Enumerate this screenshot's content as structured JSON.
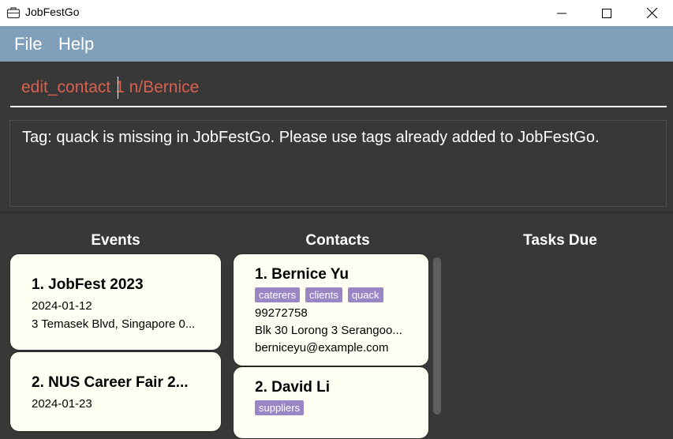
{
  "window": {
    "title": "JobFestGo",
    "app_icon": "briefcase-icon",
    "controls": [
      "minimize-icon",
      "maximize-icon",
      "close-icon"
    ]
  },
  "menu": {
    "file": "File",
    "help": "Help"
  },
  "command": {
    "value": "edit_contact 1 n/Bernice"
  },
  "result": {
    "message": "Tag: quack is missing in JobFestGo. Please use tags already added to JobFestGo."
  },
  "columns": {
    "events": "Events",
    "contacts": "Contacts",
    "tasks": "Tasks Due"
  },
  "events": [
    {
      "index_title": "1.  JobFest 2023",
      "date": "2024-01-12",
      "address": "3 Temasek Blvd, Singapore 0..."
    },
    {
      "index_title": "2.  NUS Career Fair 2...",
      "date": "2024-01-23"
    }
  ],
  "contacts": [
    {
      "index_name": "1.  Bernice Yu",
      "tags": [
        "caterers",
        "clients",
        "quack"
      ],
      "phone": "99272758",
      "address": "Blk 30 Lorong 3 Serangoo...",
      "email": "berniceyu@example.com"
    },
    {
      "index_name": "2.  David Li",
      "tags": [
        "suppliers"
      ]
    }
  ],
  "colors": {
    "background": "#383838",
    "menubar": "#7f9fba",
    "command_text": "#d9604e",
    "card": "#fffff3",
    "tag": "#9a86c5"
  }
}
